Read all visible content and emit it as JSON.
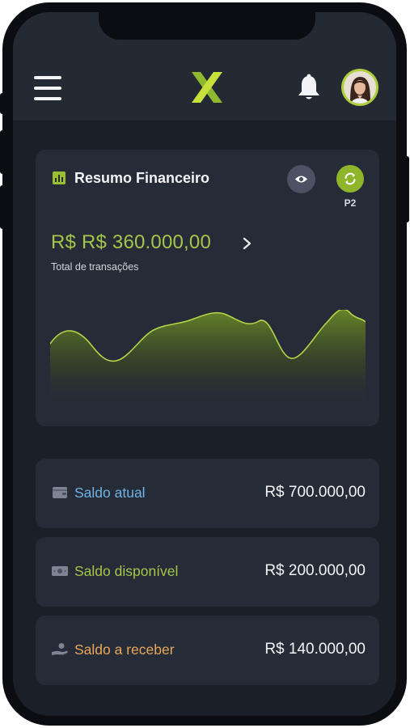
{
  "header": {
    "menu_icon": "hamburger-menu-icon",
    "logo_icon": "x-logo-icon",
    "notification_icon": "bell-icon",
    "avatar": "user-avatar"
  },
  "summary": {
    "title": "Resumo Financeiro",
    "title_icon": "bar-chart-icon",
    "visibility_icon": "eye-icon",
    "refresh_icon": "refresh-icon",
    "refresh_caption": "P2",
    "amount": "R$ R$ 360.000,00",
    "amount_icon": "chevron-right-icon",
    "amount_caption": "Total de transações",
    "accent_color": "#a4c64a"
  },
  "balances": [
    {
      "label": "Saldo atual",
      "value": "R$ 700.000,00",
      "icon": "wallet-icon",
      "color": "#6fb3e6"
    },
    {
      "label": "Saldo disponível",
      "value": "R$ 200.000,00",
      "icon": "banknote-icon",
      "color": "#a4c64a"
    },
    {
      "label": "Saldo a receber",
      "value": "R$ 140.000,00",
      "icon": "hand-money-icon",
      "color": "#e9a659"
    }
  ]
}
